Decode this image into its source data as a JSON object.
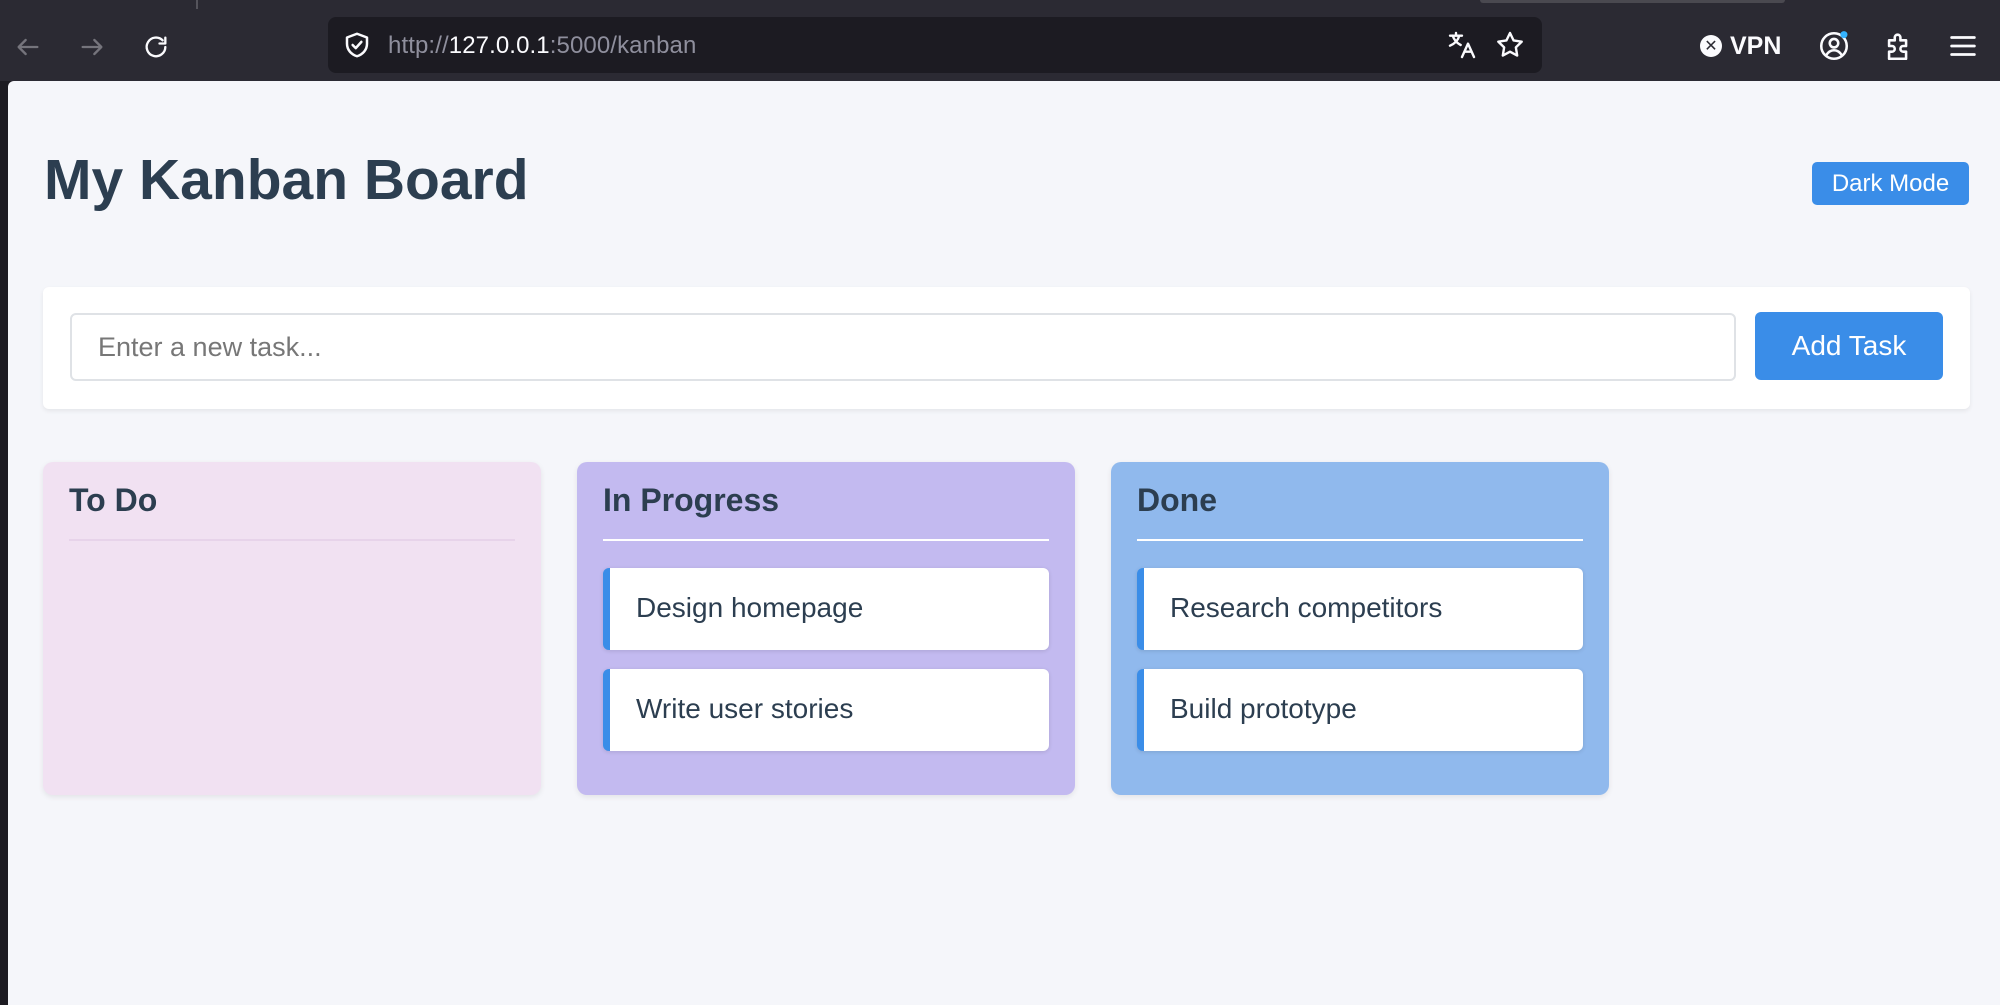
{
  "browser": {
    "url_scheme": "http://",
    "url_host": "127.0.0.1",
    "url_rest": ":5000/kanban",
    "vpn_label": "VPN",
    "icons": {
      "back": "arrow-left-icon",
      "forward": "arrow-right-icon",
      "reload": "reload-icon",
      "shield": "shield-check-icon",
      "translate": "translate-icon",
      "bookmark": "star-icon",
      "account": "account-icon",
      "extensions": "puzzle-icon",
      "menu": "hamburger-menu-icon"
    }
  },
  "header": {
    "title": "My Kanban Board",
    "dark_mode_label": "Dark Mode"
  },
  "add_task": {
    "placeholder": "Enter a new task...",
    "value": "",
    "button_label": "Add Task"
  },
  "columns": [
    {
      "title": "To Do",
      "background": "#f1e1f2",
      "rule_color": "#e7d3ea",
      "cards": []
    },
    {
      "title": "In Progress",
      "background": "#c3baf0",
      "rule_color": "#ffffff",
      "cards": [
        "Design homepage",
        "Write user stories"
      ]
    },
    {
      "title": "Done",
      "background": "#90b9ed",
      "rule_color": "#ffffff",
      "cards": [
        "Research competitors",
        "Build prototype"
      ]
    }
  ],
  "colors": {
    "accent": "#3a8de8",
    "title_text": "#2c3e50",
    "page_bg": "#f5f6fa"
  }
}
